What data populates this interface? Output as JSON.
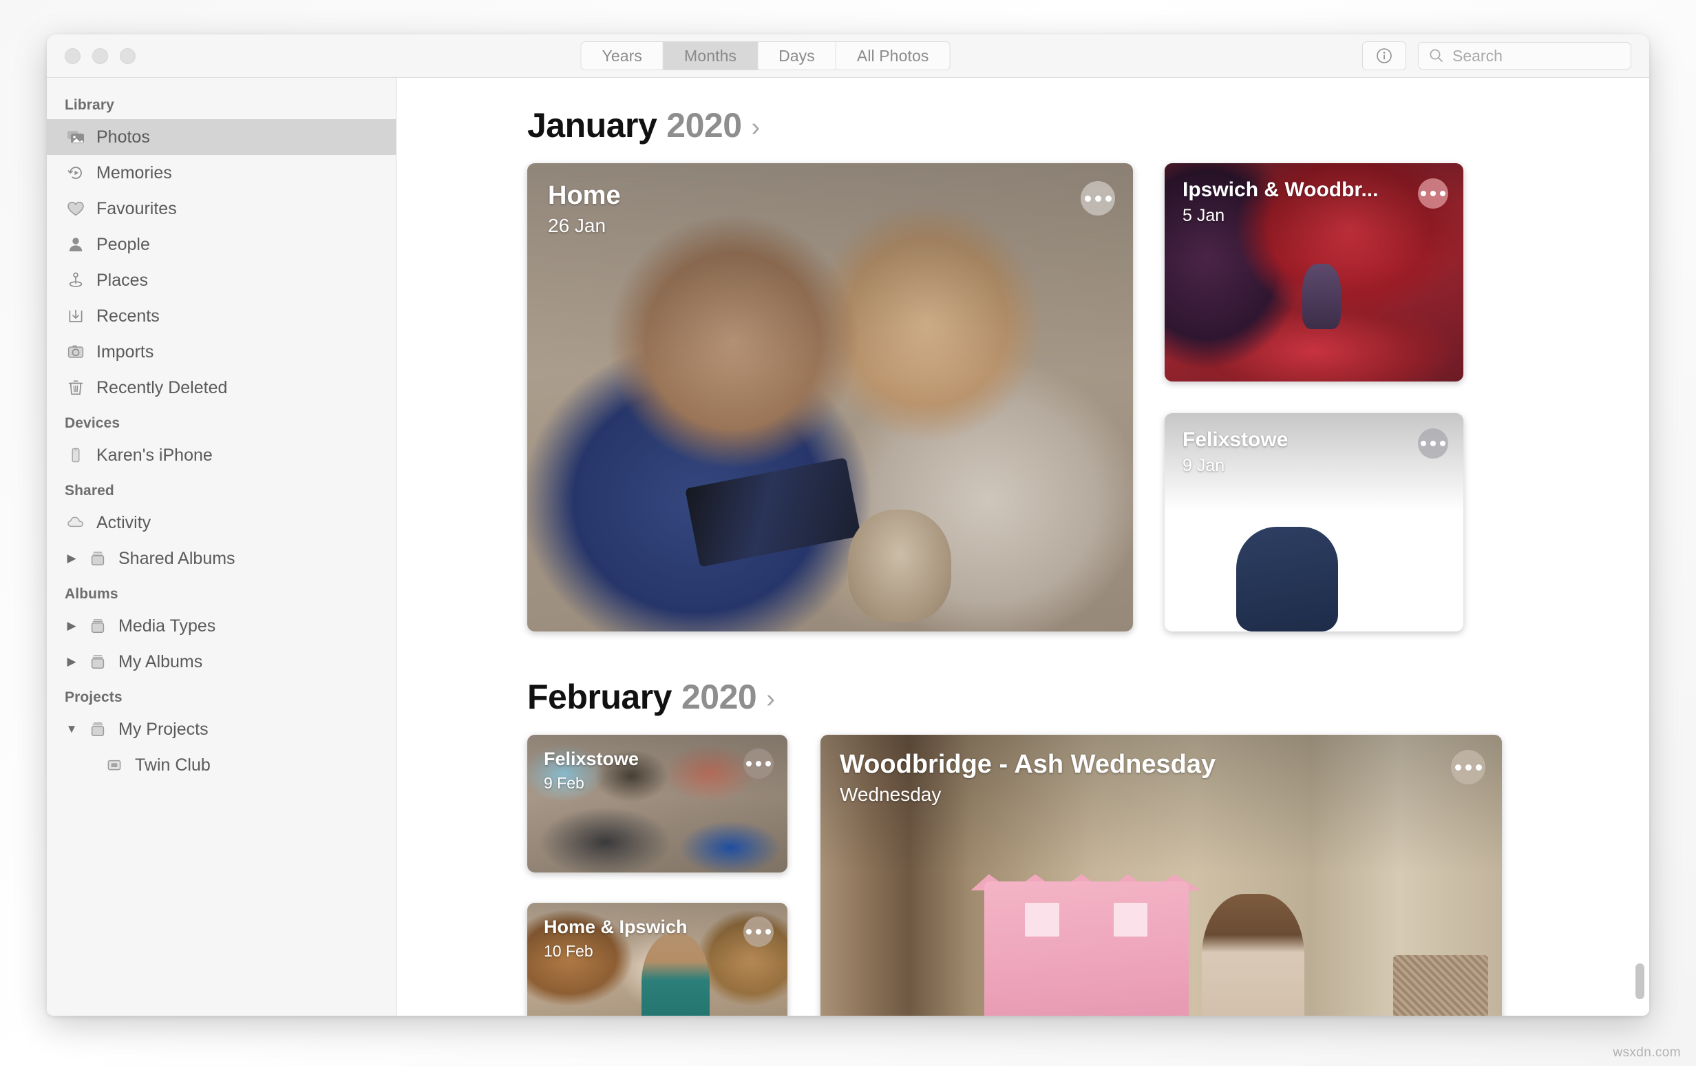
{
  "window": {
    "traffic_lights": [
      "close",
      "minimize",
      "zoom"
    ]
  },
  "toolbar": {
    "segments": [
      {
        "label": "Years",
        "selected": false
      },
      {
        "label": "Months",
        "selected": true
      },
      {
        "label": "Days",
        "selected": false
      },
      {
        "label": "All Photos",
        "selected": false
      }
    ],
    "info_button": "info-icon",
    "search": {
      "placeholder": "Search",
      "value": ""
    }
  },
  "sidebar": {
    "sections": [
      {
        "header": "Library",
        "items": [
          {
            "label": "Photos",
            "icon": "photos-icon",
            "selected": true,
            "disclosure": null,
            "indent": false
          },
          {
            "label": "Memories",
            "icon": "memories-icon",
            "selected": false,
            "disclosure": null,
            "indent": false
          },
          {
            "label": "Favourites",
            "icon": "heart-icon",
            "selected": false,
            "disclosure": null,
            "indent": false
          },
          {
            "label": "People",
            "icon": "person-icon",
            "selected": false,
            "disclosure": null,
            "indent": false
          },
          {
            "label": "Places",
            "icon": "pin-icon",
            "selected": false,
            "disclosure": null,
            "indent": false
          },
          {
            "label": "Recents",
            "icon": "download-icon",
            "selected": false,
            "disclosure": null,
            "indent": false
          },
          {
            "label": "Imports",
            "icon": "camera-icon",
            "selected": false,
            "disclosure": null,
            "indent": false
          },
          {
            "label": "Recently Deleted",
            "icon": "trash-icon",
            "selected": false,
            "disclosure": null,
            "indent": false
          }
        ]
      },
      {
        "header": "Devices",
        "items": [
          {
            "label": "Karen's iPhone",
            "icon": "iphone-icon",
            "selected": false,
            "disclosure": null,
            "indent": false
          }
        ]
      },
      {
        "header": "Shared",
        "items": [
          {
            "label": "Activity",
            "icon": "cloud-icon",
            "selected": false,
            "disclosure": null,
            "indent": false
          },
          {
            "label": "Shared Albums",
            "icon": "folder-icon",
            "selected": false,
            "disclosure": "collapsed",
            "indent": false
          }
        ]
      },
      {
        "header": "Albums",
        "items": [
          {
            "label": "Media Types",
            "icon": "folder-icon",
            "selected": false,
            "disclosure": "collapsed",
            "indent": false
          },
          {
            "label": "My Albums",
            "icon": "folder-icon",
            "selected": false,
            "disclosure": "collapsed",
            "indent": false
          }
        ]
      },
      {
        "header": "Projects",
        "items": [
          {
            "label": "My Projects",
            "icon": "folder-icon",
            "selected": false,
            "disclosure": "expanded",
            "indent": false
          },
          {
            "label": "Twin Club",
            "icon": "project-icon",
            "selected": false,
            "disclosure": null,
            "indent": true
          }
        ]
      }
    ]
  },
  "content": {
    "months": [
      {
        "name": "January",
        "year": "2020",
        "chevron": "chevron-right-icon",
        "cards": [
          {
            "title": "Home",
            "subtitle": "26 Jan",
            "size": "big",
            "menu": "more-options-icon"
          },
          {
            "title": "Ipswich & Woodbr...",
            "subtitle": "5 Jan",
            "size": "med",
            "menu": "more-options-icon"
          },
          {
            "title": "Felixstowe",
            "subtitle": "9 Jan",
            "size": "med",
            "menu": "more-options-icon"
          }
        ]
      },
      {
        "name": "February",
        "year": "2020",
        "chevron": "chevron-right-icon",
        "cards": [
          {
            "title": "Felixstowe",
            "subtitle": "9 Feb",
            "size": "sm",
            "menu": "more-options-icon"
          },
          {
            "title": "Home & Ipswich",
            "subtitle": "10 Feb",
            "size": "sm",
            "menu": "more-options-icon"
          },
          {
            "title": "Woodbridge - Ash Wednesday",
            "subtitle": "Wednesday",
            "size": "big",
            "menu": "more-options-icon"
          }
        ]
      }
    ]
  },
  "watermark": "wsxdn.com",
  "colors": {
    "sidebar_bg": "#f6f6f6",
    "selected_row": "#d4d4d4",
    "titlebar_bg": "#f6f6f6",
    "segment_active": "#d8d8d8",
    "month_name": "#111111",
    "month_year": "#8e8e8e"
  }
}
